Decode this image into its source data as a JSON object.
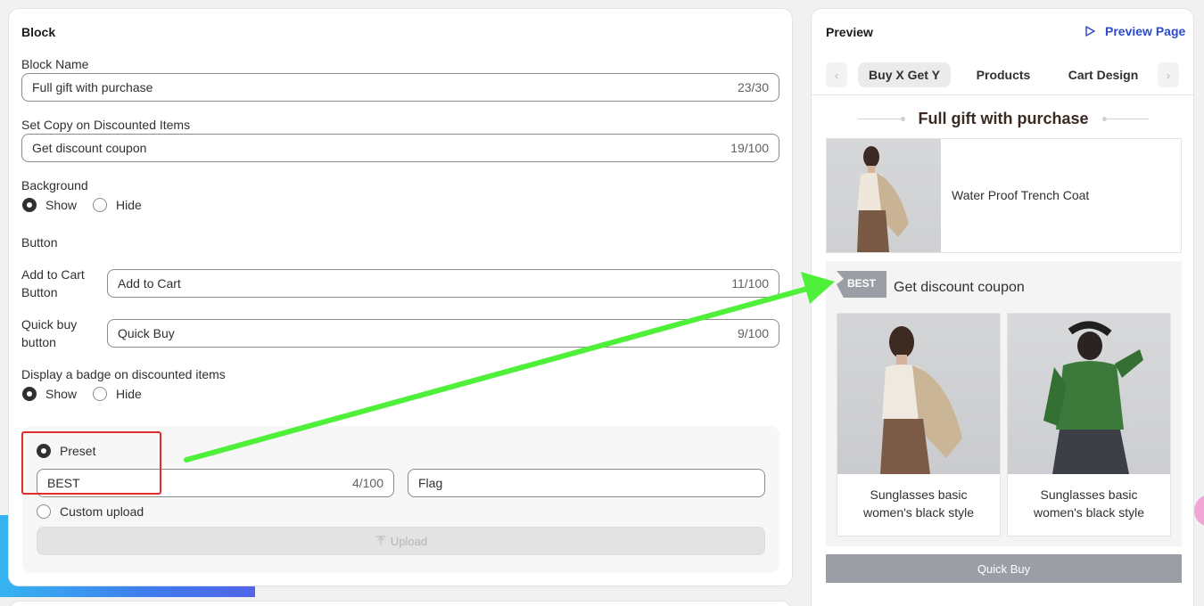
{
  "left": {
    "title": "Block",
    "block_name": {
      "label": "Block Name",
      "value": "Full gift with purchase",
      "count": "23/30"
    },
    "copy": {
      "label": "Set Copy on Discounted Items",
      "value": "Get discount coupon",
      "count": "19/100"
    },
    "background": {
      "label": "Background",
      "show": "Show",
      "hide": "Hide"
    },
    "button_section": "Button",
    "add_to_cart": {
      "label_line1": "Add to Cart",
      "label_line2": "Button",
      "value": "Add to Cart",
      "count": "11/100"
    },
    "quick_buy": {
      "label_line1": "Quick buy",
      "label_line2": "button",
      "value": "Quick Buy",
      "count": "9/100"
    },
    "badge": {
      "label": "Display a badge on discounted items",
      "show": "Show",
      "hide": "Hide"
    },
    "preset": {
      "label": "Preset",
      "value": "BEST",
      "count": "4/100",
      "style_value": "Flag"
    },
    "custom_upload": {
      "label": "Custom upload",
      "upload_button": "Upload"
    }
  },
  "right": {
    "title": "Preview",
    "preview_page": "Preview Page",
    "tabs": [
      {
        "label": "Buy X Get Y"
      },
      {
        "label": "Products"
      },
      {
        "label": "Cart Design"
      }
    ],
    "block_title": "Full gift with purchase",
    "main_product": "Water Proof Trench Coat",
    "badge_text": "BEST",
    "discount_copy": "Get discount coupon",
    "products": [
      {
        "line1": "Sunglasses basic",
        "line2": "women's black style"
      },
      {
        "line1": "Sunglasses basic",
        "line2": "women's black style"
      }
    ],
    "quick_buy_button": "Quick Buy"
  },
  "colors": {
    "accent_blue": "#2c6ecb",
    "highlight_red": "#e22b2b",
    "arrow_green": "#4ff03a",
    "badge_gray": "#9b9ea4"
  }
}
